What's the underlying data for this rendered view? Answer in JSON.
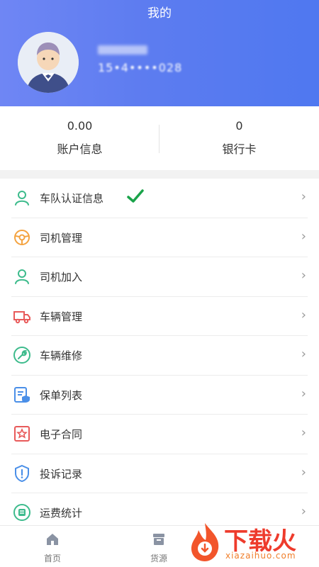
{
  "header": {
    "title": "我的",
    "phone_number": "15•4••••028"
  },
  "stats": [
    {
      "value": "0.00",
      "label": "账户信息"
    },
    {
      "value": "0",
      "label": "银行卡"
    }
  ],
  "menu": [
    {
      "label": "车队认证信息",
      "icon": "person-icon",
      "color": "#3dbb8c",
      "verified": true
    },
    {
      "label": "司机管理",
      "icon": "steering-wheel-icon",
      "color": "#f4a340"
    },
    {
      "label": "司机加入",
      "icon": "person-icon",
      "color": "#3dbb8c"
    },
    {
      "label": "车辆管理",
      "icon": "truck-icon",
      "color": "#e85a5a"
    },
    {
      "label": "车辆维修",
      "icon": "wrench-icon",
      "color": "#3dbb8c"
    },
    {
      "label": "保单列表",
      "icon": "policy-list-icon",
      "color": "#4a8fe8"
    },
    {
      "label": "电子合同",
      "icon": "contract-icon",
      "color": "#e85a5a"
    },
    {
      "label": "投诉记录",
      "icon": "shield-alert-icon",
      "color": "#4a8fe8"
    },
    {
      "label": "运费统计",
      "icon": "freight-stats-icon",
      "color": "#3dbb8c"
    }
  ],
  "tabbar": {
    "home": "首页",
    "cargo": "货源"
  },
  "watermark": {
    "brand": "下载火",
    "url": "xiazaihuo.com"
  },
  "colors": {
    "header_start": "#6f86f4",
    "header_end": "#4f78f0",
    "check": "#1aa34a"
  }
}
